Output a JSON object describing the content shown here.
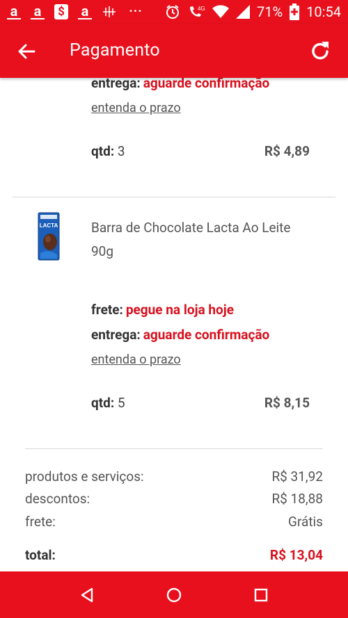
{
  "status_bar": {
    "left_glyphs": [
      "a",
      "a",
      "$",
      "a"
    ],
    "dots": "···",
    "battery_percent": "71%",
    "time": "10:54",
    "network": "4G"
  },
  "app_bar": {
    "title": "Pagamento"
  },
  "items": [
    {
      "entrega_label": "entrega:",
      "entrega_value": "aguarde confirmação",
      "prazo_link": "entenda o prazo",
      "qtd_label": "qtd:",
      "qtd_value": "3",
      "price": "R$ 4,89"
    },
    {
      "name": "Barra de Chocolate Lacta Ao Leite 90g",
      "thumb_text": "LACTA",
      "frete_label": "frete:",
      "frete_value": "pegue na loja hoje",
      "entrega_label": "entrega:",
      "entrega_value": "aguarde confirmação",
      "prazo_link": "entenda o prazo",
      "qtd_label": "qtd:",
      "qtd_value": "5",
      "price": "R$ 8,15"
    }
  ],
  "summary": {
    "products_label": "produtos e serviços:",
    "products_value": "R$ 31,92",
    "discounts_label": "descontos:",
    "discounts_value": "R$ 18,88",
    "shipping_label": "frete:",
    "shipping_value": "Grátis",
    "total_label": "total:",
    "total_value": "R$ 13,04"
  },
  "colors": {
    "brand_red": "#e8101d",
    "accent_red_text": "#d8101d"
  }
}
